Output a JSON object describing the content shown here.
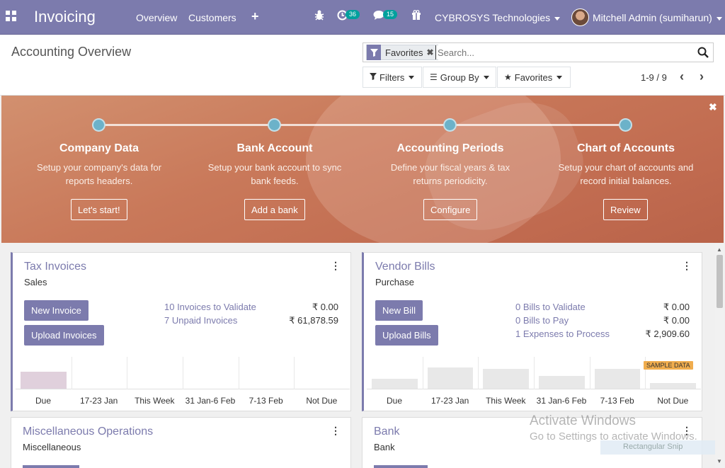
{
  "navbar": {
    "brand": "Invoicing",
    "menu": [
      "Overview",
      "Customers"
    ],
    "activity_count": "36",
    "messages_count": "15",
    "company": "CYBROSYS Technologies",
    "user": "Mitchell Admin (sumiharun)"
  },
  "control_panel": {
    "breadcrumb": "Accounting Overview",
    "facet_label": "Favorites",
    "search_placeholder": "Search...",
    "filters_label": "Filters",
    "groupby_label": "Group By",
    "favorites_label": "Favorites",
    "pager": "1-9 / 9"
  },
  "banner": {
    "steps": [
      {
        "title": "Company Data",
        "desc": "Setup your company's data for reports headers.",
        "button": "Let's start!"
      },
      {
        "title": "Bank Account",
        "desc": "Setup your bank account to sync bank feeds.",
        "button": "Add a bank"
      },
      {
        "title": "Accounting Periods",
        "desc": "Define your fiscal years & tax returns periodicity.",
        "button": "Configure"
      },
      {
        "title": "Chart of Accounts",
        "desc": "Setup your chart of accounts and record initial balances.",
        "button": "Review"
      }
    ]
  },
  "cards": {
    "tax_invoices": {
      "title": "Tax Invoices",
      "subtitle": "Sales",
      "buttons": [
        "New Invoice",
        "Upload Invoices"
      ],
      "stats": [
        {
          "label": "10 Invoices to Validate",
          "amount": "₹ 0.00"
        },
        {
          "label": "7 Unpaid Invoices",
          "amount": "₹ 61,878.59"
        }
      ]
    },
    "vendor_bills": {
      "title": "Vendor Bills",
      "subtitle": "Purchase",
      "buttons": [
        "New Bill",
        "Upload Bills"
      ],
      "stats": [
        {
          "label": "0 Bills to Validate",
          "amount": "₹ 0.00"
        },
        {
          "label": "0 Bills to Pay",
          "amount": "₹ 0.00"
        },
        {
          "label": "1 Expenses to Process",
          "amount": "₹ 2,909.60"
        }
      ],
      "sample_badge": "SAMPLE DATA"
    },
    "misc": {
      "title": "Miscellaneous Operations",
      "subtitle": "Miscellaneous"
    },
    "bank": {
      "title": "Bank",
      "subtitle": "Bank"
    }
  },
  "chart_data": [
    {
      "type": "bar",
      "categories": [
        "Due",
        "17-23 Jan",
        "This Week",
        "31 Jan-6 Feb",
        "7-13 Feb",
        "Not Due"
      ],
      "series": [
        {
          "values": [
            0.6,
            0,
            0,
            0,
            0,
            0
          ]
        }
      ],
      "color": "#e0d0dc"
    },
    {
      "type": "bar",
      "categories": [
        "Due",
        "17-23 Jan",
        "This Week",
        "31 Jan-6 Feb",
        "7-13 Feb",
        "Not Due"
      ],
      "series": [
        {
          "values": [
            0.35,
            0.75,
            0.7,
            0.45,
            0.7,
            0.2
          ]
        }
      ],
      "color": "#e8e8e8"
    }
  ],
  "overlay": {
    "watermark_title": "Activate Windows",
    "watermark_text": "Go to Settings to activate Windows.",
    "snip_label": "Rectangular Snip"
  },
  "colors": {
    "primary": "#7c7bad",
    "accent_teal": "#00a09d",
    "banner": "#c9795a",
    "badge": "#f0ad4e"
  }
}
